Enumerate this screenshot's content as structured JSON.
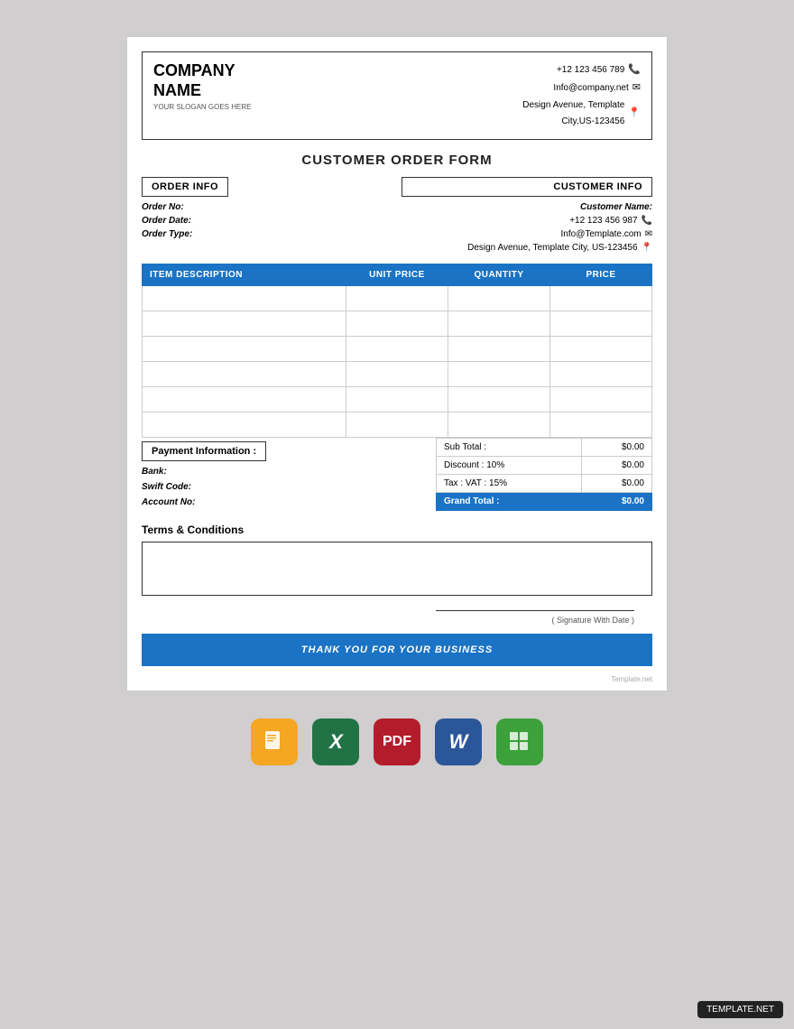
{
  "document": {
    "title": "CUSTOMER ORDER FORM",
    "company": {
      "name_line1": "COMPANY",
      "name_line2": "NAME",
      "slogan": "YOUR SLOGAN GOES HERE"
    },
    "contact": {
      "phone": "+12 123 456 789",
      "email": "Info@company.net",
      "address_line1": "Design Avenue, Template",
      "address_line2": "City,US-123456"
    },
    "order_info": {
      "section_label": "ORDER INFO",
      "fields": [
        {
          "label": "Order No:",
          "value": ""
        },
        {
          "label": "Order Date:",
          "value": ""
        },
        {
          "label": "Order Type:",
          "value": ""
        }
      ]
    },
    "customer_info": {
      "section_label": "CUSTOMER INFO",
      "name_label": "Customer Name:",
      "phone": "+12 123 456 987",
      "email": "Info@Template.com",
      "address": "Design Avenue, Template City, US-123456"
    },
    "table": {
      "headers": [
        "ITEM DESCRIPTION",
        "UNIT PRICE",
        "QUANTITY",
        "PRICE"
      ],
      "rows": [
        [
          "",
          "",
          "",
          ""
        ],
        [
          "",
          "",
          "",
          ""
        ],
        [
          "",
          "",
          "",
          ""
        ],
        [
          "",
          "",
          "",
          ""
        ],
        [
          "",
          "",
          "",
          ""
        ],
        [
          "",
          "",
          "",
          ""
        ]
      ]
    },
    "payment": {
      "section_label": "Payment Information :",
      "bank_label": "Bank:",
      "swift_label": "Swift Code:",
      "account_label": "Account No:"
    },
    "totals": {
      "subtotal_label": "Sub Total :",
      "subtotal_value": "$0.00",
      "discount_label": "Discount : 10%",
      "discount_value": "$0.00",
      "tax_label": "Tax : VAT : 15%",
      "tax_value": "$0.00",
      "grand_label": "Grand Total :",
      "grand_value": "$0.00"
    },
    "terms": {
      "title": "Terms & Conditions"
    },
    "signature": {
      "label": "( Signature With Date )"
    },
    "footer": {
      "thank_you": "THANK YOU FOR YOUR BUSINESS",
      "watermark": "Template.net"
    }
  },
  "app_icons": [
    {
      "name": "Pages",
      "icon": "📄",
      "class": "app-icon-pages"
    },
    {
      "name": "Excel",
      "icon": "X",
      "class": "app-icon-excel"
    },
    {
      "name": "PDF",
      "icon": "A",
      "class": "app-icon-pdf"
    },
    {
      "name": "Word",
      "icon": "W",
      "class": "app-icon-word"
    },
    {
      "name": "Numbers",
      "icon": "N",
      "class": "app-icon-numbers"
    }
  ],
  "template_badge": "TEMPLATE.NET"
}
